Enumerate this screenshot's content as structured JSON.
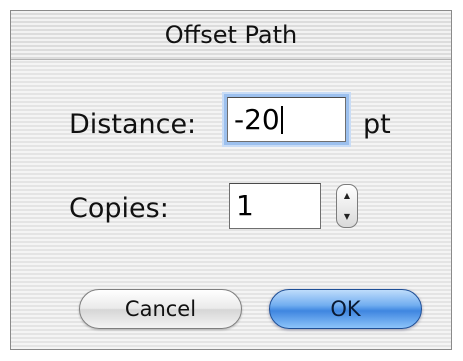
{
  "dialog": {
    "title": "Offset Path"
  },
  "distance": {
    "label": "Distance:",
    "value": "-20",
    "unit": "pt"
  },
  "copies": {
    "label": "Copies:",
    "value": "1"
  },
  "buttons": {
    "cancel_label": "Cancel",
    "ok_label": "OK"
  },
  "icons": {
    "stepper": "up-down-stepper-icon"
  },
  "colors": {
    "default_button": "#3f86e0",
    "focus_ring": "#9cc0ee"
  }
}
